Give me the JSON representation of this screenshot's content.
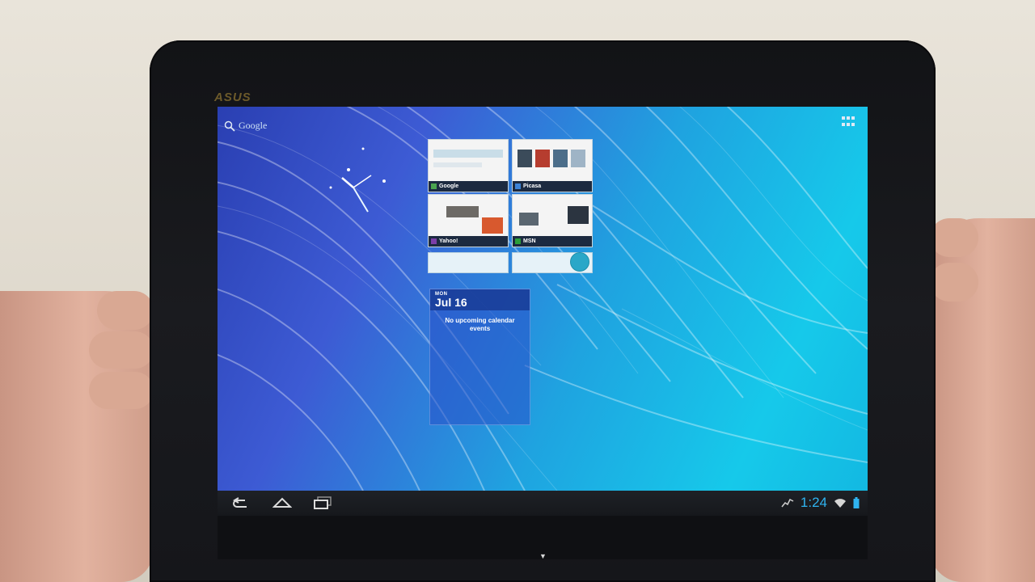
{
  "device": {
    "brand_logo": "ASUS"
  },
  "home_screen": {
    "search_label": "Google",
    "icons": {
      "search": "search-icon",
      "apps": "apps-grid-icon",
      "clock": "analog-clock-icon"
    }
  },
  "browser_bookmarks_widget": {
    "items": [
      {
        "label": "Google"
      },
      {
        "label": "Picasa"
      },
      {
        "label": "Yahoo!"
      },
      {
        "label": "MSN"
      }
    ]
  },
  "calendar_widget": {
    "day_of_week": "MON",
    "date": "Jul 16",
    "empty_message": "No upcoming calendar events"
  },
  "system_bar": {
    "time": "1:24",
    "icons": [
      "back-icon",
      "home-icon",
      "recent-apps-icon",
      "activity-icon",
      "wifi-icon",
      "battery-icon"
    ]
  },
  "colors": {
    "screen_accent": "#16c9ea",
    "clock_text": "#2fb3ef",
    "system_bar": "#1b1d22"
  }
}
